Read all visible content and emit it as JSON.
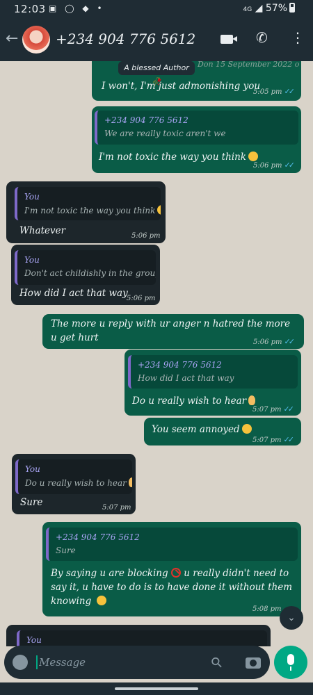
{
  "status_bar": {
    "time": "12:03",
    "network": "4G",
    "battery": "57%"
  },
  "header": {
    "contact": "+234 904 776 5612"
  },
  "top": {
    "date_pill": "A blessed Author 🥀",
    "overlapped_text": "Don   15 September 2022    o"
  },
  "messages": [
    {
      "dir": "out",
      "text": "I won't, I'm just admonishing you",
      "time": "5:05 pm"
    },
    {
      "dir": "out",
      "reply_name": "+234 904 776 5612",
      "reply_text": "We are really toxic aren't we",
      "text": "I'm not toxic the way you think",
      "time": "5:06 pm"
    },
    {
      "dir": "in",
      "reply_name": "You",
      "reply_text": "I'm not toxic the way you think",
      "text": "Whatever",
      "time": "5:06 pm"
    },
    {
      "dir": "in",
      "reply_name": "You",
      "reply_text": "Don't act childishly in the group",
      "text": "How did I act that way",
      "time": "5:06 pm"
    },
    {
      "dir": "out",
      "text": "The more u reply with ur anger n hatred the more u get hurt",
      "time": "5:06 pm"
    },
    {
      "dir": "out",
      "reply_name": "+234 904 776 5612",
      "reply_text": "How did I act that way",
      "text": "Do u really wish to hear",
      "time": "5:07 pm"
    },
    {
      "dir": "out",
      "text": "You seem annoyed",
      "time": "5:07 pm"
    },
    {
      "dir": "in",
      "reply_name": "You",
      "reply_text": "Do u really wish to hear",
      "text": "Sure",
      "time": "5:07 pm"
    },
    {
      "dir": "out",
      "reply_name": "+234 904 776 5612",
      "reply_text": "Sure",
      "text_a": "By saying u are blocking",
      "text_b": "u really didn't need to say it, u have to do is to have done it without them knowing",
      "time": "5:08 pm"
    },
    {
      "dir": "in",
      "reply_name": "You"
    }
  ],
  "composer": {
    "placeholder": "Message"
  },
  "colors": {
    "outgoing": "#0a5c47",
    "incoming": "#1d262b",
    "accent": "#00a884",
    "read_ticks": "#53bdeb",
    "reply_bar": "#7e69c9"
  },
  "icons": [
    "back-arrow-icon",
    "video-call-icon",
    "phone-icon",
    "more-vert-icon",
    "emoji-icon",
    "attach-icon",
    "camera-icon",
    "mic-icon",
    "chevron-double-down-icon"
  ]
}
